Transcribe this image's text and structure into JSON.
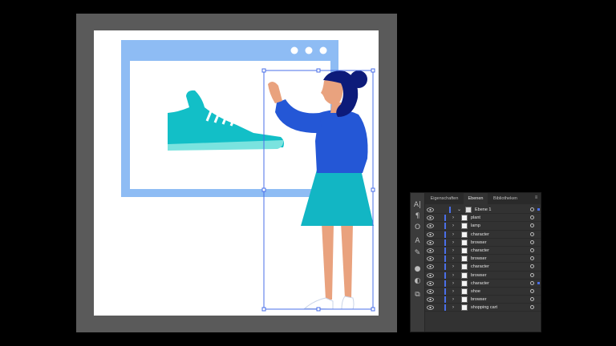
{
  "colors": {
    "background": "#000000",
    "pasteboard": "#5a5a5a",
    "artboard": "#ffffff",
    "browser_frame": "#8ebcf4",
    "shoe": "#12bfc7",
    "shoe_sole": "#7ae3df",
    "character_dark": "#0d1b7a",
    "sweater": "#2457d6",
    "skirt": "#12b6c4",
    "skin": "#e9a27e",
    "selection": "#4a6fe8",
    "panel_bg": "#323232"
  },
  "tool_icons": [
    "character-panel-icon",
    "paragraph-icon",
    "opentype-icon",
    "glyph-icon",
    "brush-icon",
    "appearance-icon",
    "color-icon",
    "layers-stack-icon"
  ],
  "tool_glyphs": [
    "A|",
    "¶",
    "O",
    "A",
    "✎",
    "●",
    "◐",
    "⧉"
  ],
  "panel": {
    "tabs": [
      "Eigenschaften",
      "Ebenen",
      "Bibliotheken"
    ],
    "active_tab": 1,
    "top_layer": "Ebene 1",
    "layers": [
      "plant",
      "lamp",
      "character",
      "browser",
      "character",
      "browser",
      "character",
      "browser",
      "character",
      "shoe",
      "browser",
      "shopping cart"
    ],
    "targeted_layer_index": 8
  }
}
